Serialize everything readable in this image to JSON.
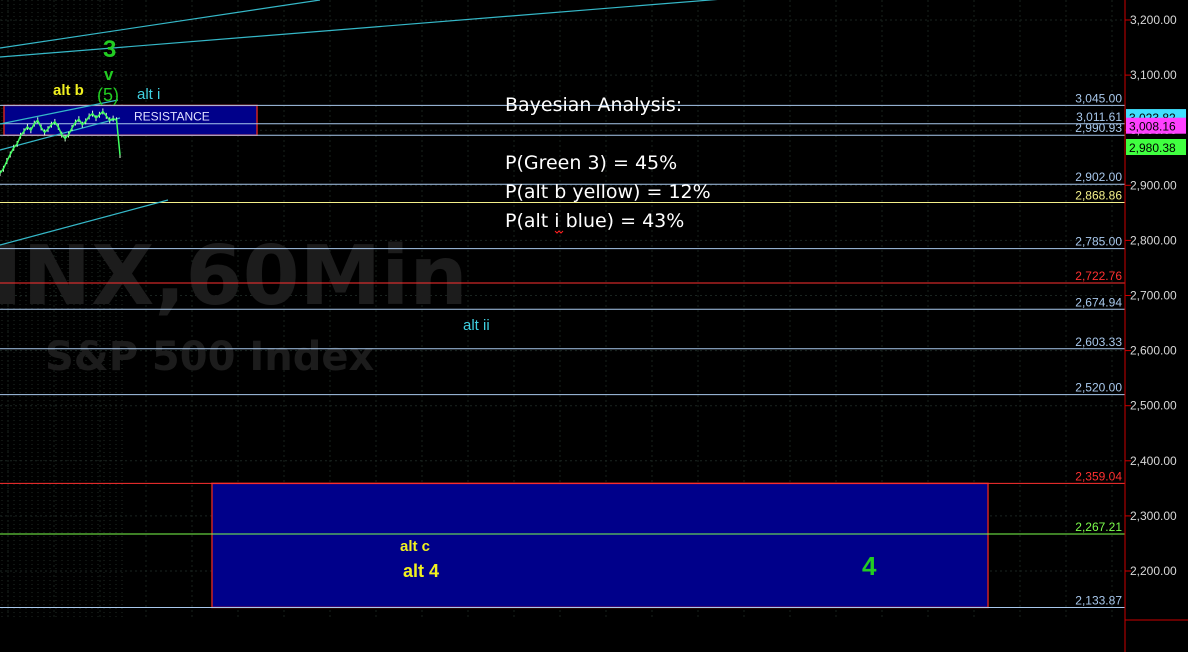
{
  "watermark": {
    "symbol": "INX,60Min",
    "name": "S&P 500 Index"
  },
  "colors": {
    "background": "#000000",
    "grid": "#1f2a24",
    "axis": "#cc0000",
    "trendline": "#35b8c8",
    "box_fill": "#00008a",
    "box_border": "#cc2222"
  },
  "chart_data": {
    "type": "line",
    "title": "",
    "ylim": [
      2100,
      3280
    ],
    "y_axis_ticks": [
      3200,
      3100,
      3000,
      2900,
      2800,
      2700,
      2600,
      2500,
      2400,
      2300,
      2200
    ],
    "y_axis_tick_labels": [
      "3,200.00",
      "3,100.00",
      "3,000.00",
      "2,900.00",
      "2,800.00",
      "2,700.00",
      "2,600.00",
      "2,500.00",
      "2,400.00",
      "2,300.00",
      "2,200.00"
    ],
    "levels": [
      {
        "value": 3045.0,
        "label": "3,045.00",
        "color": "#a8c8ec"
      },
      {
        "value": 3011.61,
        "label": "3,011.61",
        "color": "#a8c8ec"
      },
      {
        "value": 2990.93,
        "label": "2,990.93",
        "color": "#a8c8ec"
      },
      {
        "value": 2902.0,
        "label": "2,902.00",
        "color": "#a8c8ec"
      },
      {
        "value": 2868.86,
        "label": "2,868.86",
        "color": "#f4f08a"
      },
      {
        "value": 2785.0,
        "label": "2,785.00",
        "color": "#a8c8ec"
      },
      {
        "value": 2722.76,
        "label": "2,722.76",
        "color": "#ff3030"
      },
      {
        "value": 2674.94,
        "label": "2,674.94",
        "color": "#a8c8ec"
      },
      {
        "value": 2603.33,
        "label": "2,603.33",
        "color": "#a8c8ec"
      },
      {
        "value": 2520.0,
        "label": "2,520.00",
        "color": "#a8c8ec"
      },
      {
        "value": 2359.04,
        "label": "2,359.04",
        "color": "#ff3030"
      },
      {
        "value": 2267.21,
        "label": "2,267.21",
        "color": "#7cff4c"
      },
      {
        "value": 2133.87,
        "label": "2,133.87",
        "color": "#a8c8ec"
      }
    ],
    "price_tags": [
      {
        "value": 3023.82,
        "label": "3,023.82",
        "bg": "#40e0ff"
      },
      {
        "value": 3008.16,
        "label": "3,008.16",
        "bg": "#ff40ff"
      },
      {
        "value": 2980.38,
        "label": "2,980.38",
        "bg": "#40ff40"
      }
    ],
    "zones": [
      {
        "name": "resistance",
        "label": "RESISTANCE",
        "top": 3045.0,
        "bottom": 2990.93
      },
      {
        "name": "target",
        "label": "",
        "top": 2359.04,
        "bottom": 2133.87
      }
    ],
    "annotations": [
      {
        "text": "3",
        "color": "#22cc22",
        "size": 24
      },
      {
        "text": "v",
        "color": "#22cc22",
        "size": 17
      },
      {
        "text": "(5)",
        "color": "#22cc22",
        "size": 18
      },
      {
        "text": "alt b",
        "color": "#f0f020",
        "size": 15
      },
      {
        "text": "alt i",
        "color": "#40d0e0",
        "size": 15
      },
      {
        "text": "alt ii",
        "color": "#40d0e0",
        "size": 15
      },
      {
        "text": "alt c",
        "color": "#f0f020",
        "size": 15
      },
      {
        "text": "alt 4",
        "color": "#f0f020",
        "size": 18
      },
      {
        "text": "4",
        "color": "#22cc22",
        "size": 26
      }
    ],
    "price_series": [
      2922,
      2930,
      2944,
      2956,
      2968,
      2975,
      2990,
      2998,
      3006,
      3000,
      3012,
      3018,
      3005,
      2996,
      3002,
      3010,
      3015,
      3006,
      2992,
      2985,
      2992,
      3004,
      3014,
      3020,
      3010,
      3016,
      3025,
      3030,
      3022,
      3028,
      3034,
      3026,
      3018,
      3021,
      3018,
      2955
    ]
  },
  "bayesian": {
    "title": "Bayesian Analysis:",
    "lines": [
      "P(Green 3) = 45%",
      "P(alt b yellow) = 12%",
      "P(alt i blue) = 43%"
    ]
  }
}
